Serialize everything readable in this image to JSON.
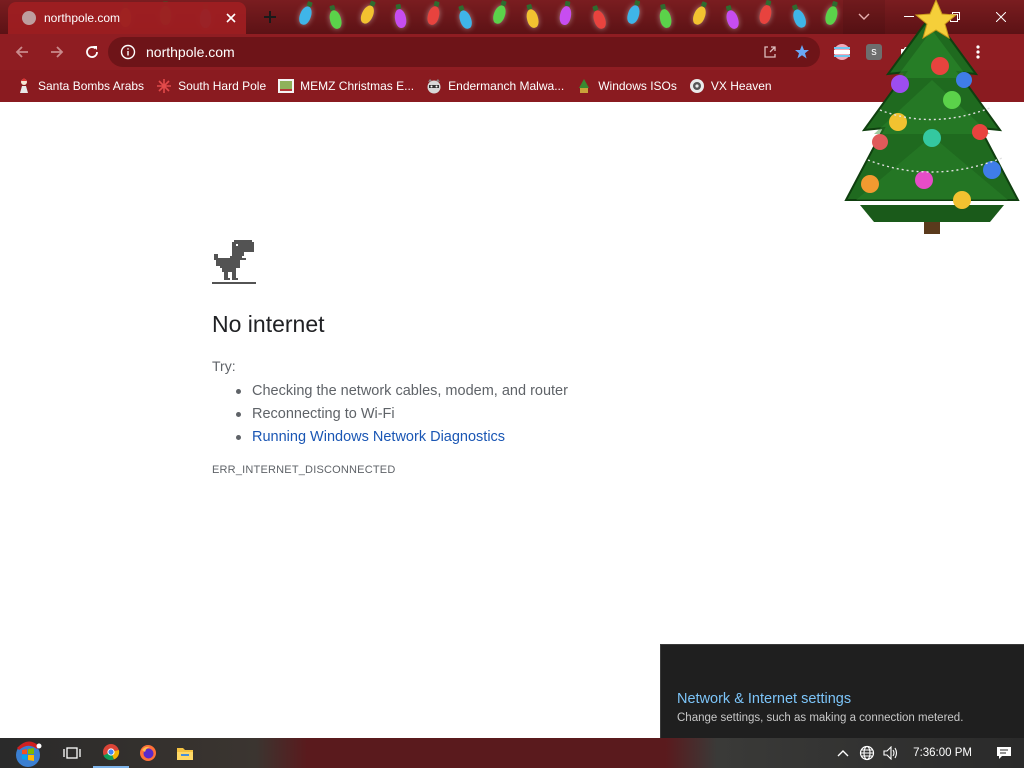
{
  "browser": {
    "tab": {
      "title": "northpole.com"
    },
    "address_bar": {
      "url": "northpole.com"
    },
    "bookmarks": [
      {
        "label": "Santa Bombs Arabs"
      },
      {
        "label": "South Hard Pole"
      },
      {
        "label": "MEMZ Christmas E..."
      },
      {
        "label": "Endermanch Malwa..."
      },
      {
        "label": "Windows ISOs"
      },
      {
        "label": "VX Heaven"
      }
    ],
    "extension_badge": "s"
  },
  "error_page": {
    "title": "No internet",
    "try_label": "Try:",
    "suggestions": [
      "Checking the network cables, modem, and router",
      "Reconnecting to Wi-Fi",
      "Running Windows Network Diagnostics"
    ],
    "error_code": "ERR_INTERNET_DISCONNECTED"
  },
  "network_flyout": {
    "settings_link": "Network & Internet settings",
    "description": "Change settings, such as making a connection metered."
  },
  "taskbar": {
    "clock": "7:36:00 PM"
  },
  "colors": {
    "theme_red": "#8f1d22",
    "link_blue": "#1a56b4",
    "flyout_bg": "#1f1f1f",
    "flyout_link": "#7cc4f8"
  },
  "icons": [
    "back-arrow-icon",
    "forward-arrow-icon",
    "reload-icon",
    "info-icon",
    "share-icon",
    "star-icon",
    "dinosaur-icon",
    "start-orb-icon",
    "task-view-icon",
    "chrome-icon",
    "firefox-icon",
    "file-explorer-icon",
    "network-globe-icon",
    "volume-icon",
    "notification-icon"
  ]
}
